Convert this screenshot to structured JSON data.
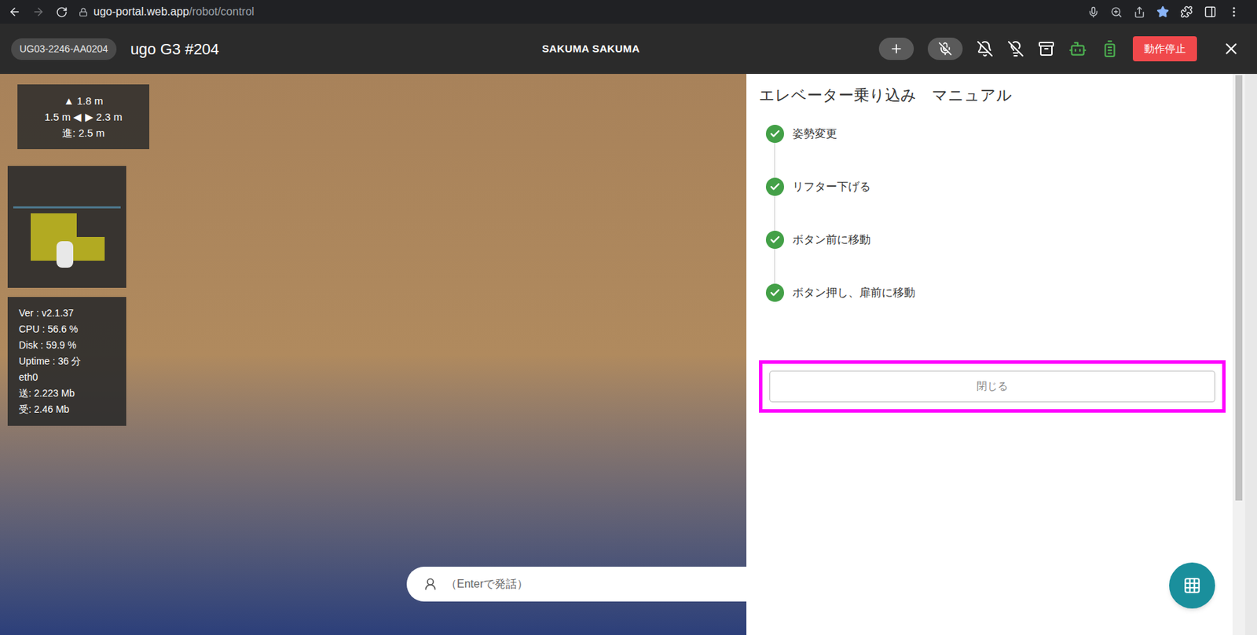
{
  "browser": {
    "url_host": "ugo-portal.web.app",
    "url_path": "/robot/control",
    "bookmarked": true
  },
  "header": {
    "badge": "UG03-2246-AA0204",
    "title": "ugo G3 #204",
    "user": "SAKUMA SAKUMA",
    "stop_button": "動作停止",
    "mic_muted": true
  },
  "distance": {
    "lines": [
      "▲ 1.8 m",
      "1.5 m ◀ ▶ 2.3 m",
      "進: 2.5 m"
    ]
  },
  "stats": {
    "lines": [
      "Ver : v2.1.37",
      "CPU : 56.6 %",
      "Disk : 59.9 %",
      "Uptime : 36 分",
      "eth0",
      "送: 2.223 Mb",
      "受: 2.46 Mb"
    ]
  },
  "speech": {
    "placeholder": "（Enterで発話）"
  },
  "manual": {
    "title": "エレベーター乗り込み　マニュアル",
    "steps": [
      {
        "label": "姿勢変更",
        "done": true
      },
      {
        "label": "リフター下げる",
        "done": true
      },
      {
        "label": "ボタン前に移動",
        "done": true
      },
      {
        "label": "ボタン押し、扉前に移動",
        "done": true
      }
    ],
    "close_button": {
      "label": "閉じる",
      "highlighted": true
    }
  }
}
